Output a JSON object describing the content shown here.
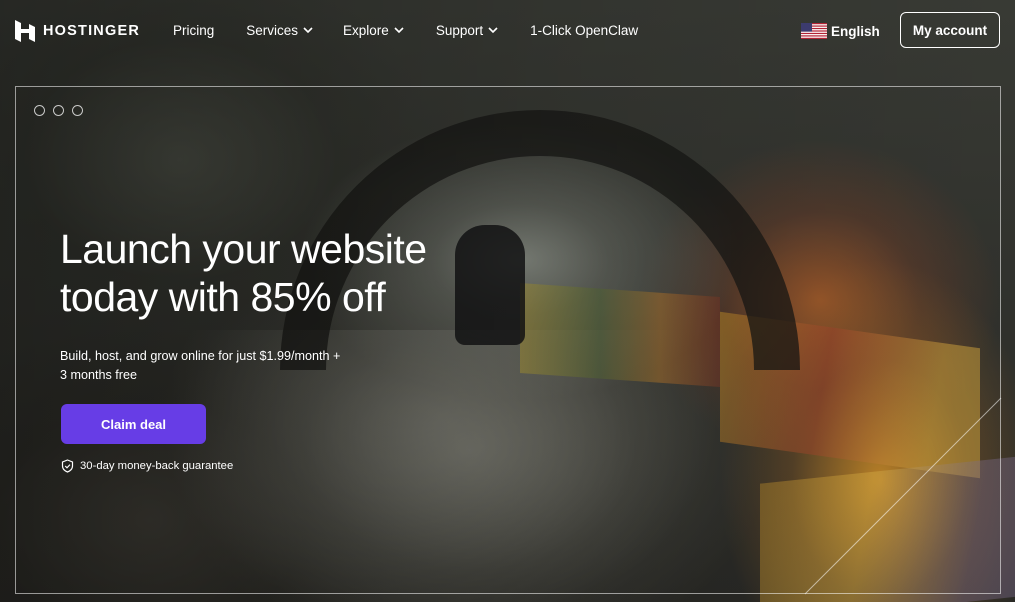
{
  "brand": {
    "name": "HOSTINGER"
  },
  "nav": {
    "items": [
      {
        "label": "Pricing",
        "dropdown": false
      },
      {
        "label": "Services",
        "dropdown": true
      },
      {
        "label": "Explore",
        "dropdown": true
      },
      {
        "label": "Support",
        "dropdown": true
      },
      {
        "label": "1-Click OpenClaw",
        "dropdown": false
      }
    ],
    "language": {
      "label": "English",
      "flag_icon": "us-flag-icon"
    },
    "account_label": "My account"
  },
  "hero": {
    "title_line1": "Launch your website",
    "title_line2": "today with 85% off",
    "subtitle_line1": "Build, host, and grow online for just $1.99/month +",
    "subtitle_line2": "3 months free",
    "cta_label": "Claim deal",
    "guarantee": "30-day money-back guarantee",
    "slide_count": 3
  },
  "colors": {
    "accent": "#673de6",
    "text": "#ffffff"
  }
}
